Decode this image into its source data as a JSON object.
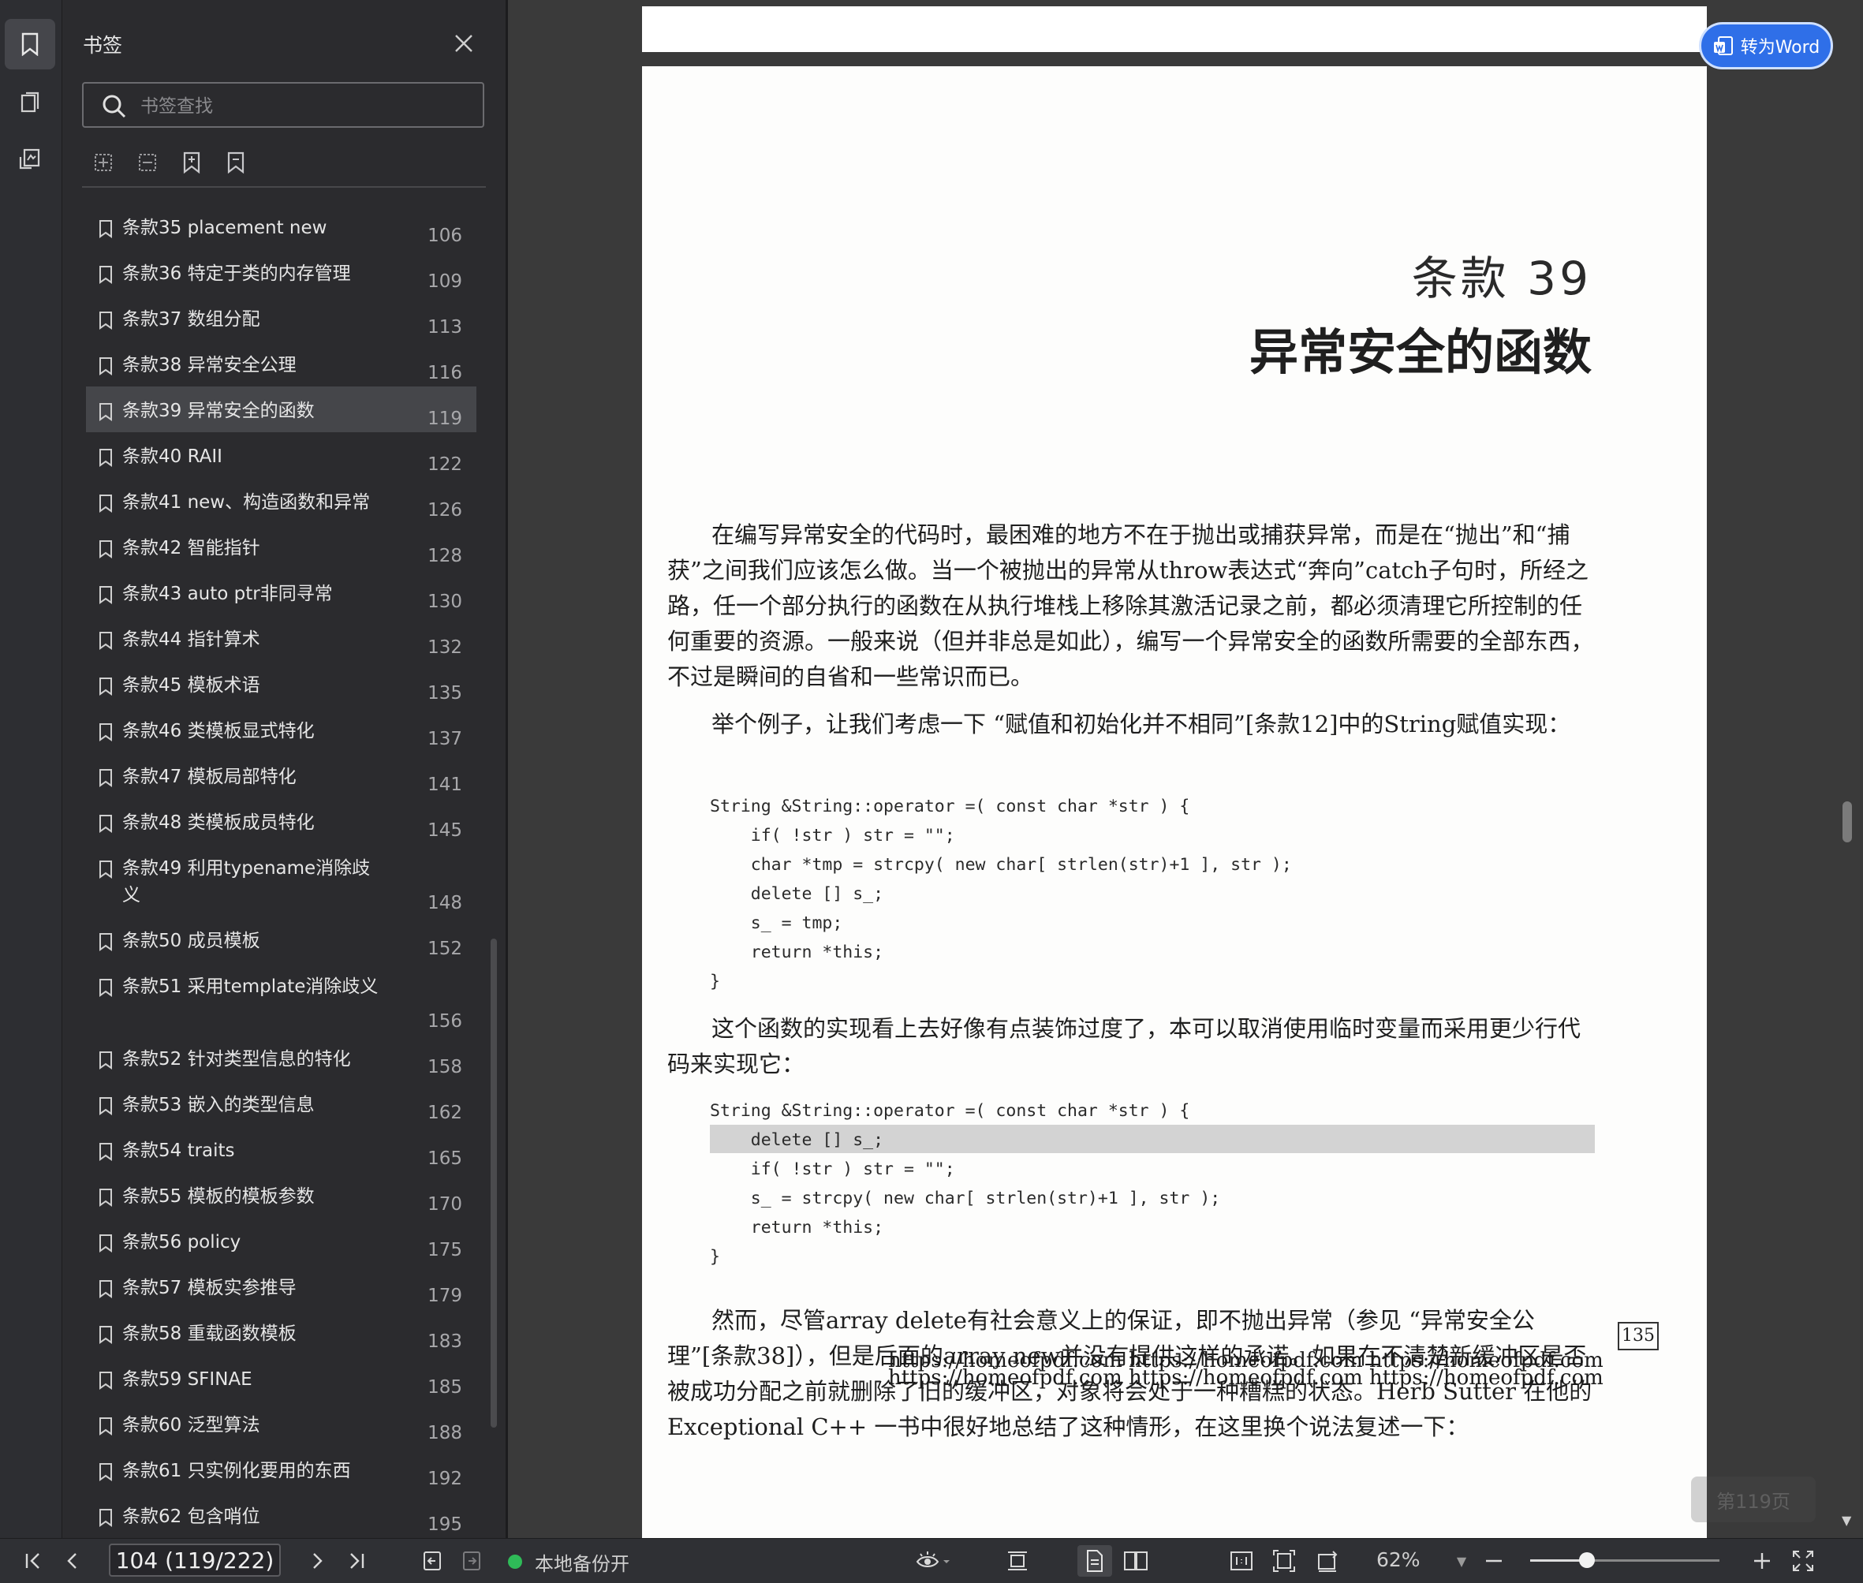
{
  "panel": {
    "title": "书签",
    "search_placeholder": "书签查找",
    "bookmarks": [
      {
        "label": "条款35  placement new",
        "page": "106"
      },
      {
        "label": "条款36  特定于类的内存管理",
        "page": "109"
      },
      {
        "label": "条款37  数组分配",
        "page": "113"
      },
      {
        "label": "条款38  异常安全公理",
        "page": "116"
      },
      {
        "label": "条款39  异常安全的函数",
        "page": "119",
        "selected": true
      },
      {
        "label": "条款40  RAII",
        "page": "122"
      },
      {
        "label": "条款41  new、构造函数和异常",
        "page": "126"
      },
      {
        "label": "条款42  智能指针",
        "page": "128"
      },
      {
        "label": "条款43  auto ptr非同寻常",
        "page": "130"
      },
      {
        "label": "条款44  指针算术",
        "page": "132"
      },
      {
        "label": "条款45  模板术语",
        "page": "135"
      },
      {
        "label": "条款46  类模板显式特化",
        "page": "137"
      },
      {
        "label": "条款47  模板局部特化",
        "page": "141"
      },
      {
        "label": "条款48  类模板成员特化",
        "page": "145"
      },
      {
        "label": "条款49  利用typename消除歧义",
        "page": "148"
      },
      {
        "label": "条款50  成员模板",
        "page": "152"
      },
      {
        "label": "条款51  采用template消除歧义",
        "page": "156"
      },
      {
        "label": "条款52  针对类型信息的特化",
        "page": "158"
      },
      {
        "label": "条款53  嵌入的类型信息",
        "page": "162"
      },
      {
        "label": "条款54  traits",
        "page": "165"
      },
      {
        "label": "条款55  模板的模板参数",
        "page": "170"
      },
      {
        "label": "条款56  policy",
        "page": "175"
      },
      {
        "label": "条款57  模板实参推导",
        "page": "179"
      },
      {
        "label": "条款58  重载函数模板",
        "page": "183"
      },
      {
        "label": "条款59  SFINAE",
        "page": "185"
      },
      {
        "label": "条款60  泛型算法",
        "page": "188"
      },
      {
        "label": "条款61  只实例化要用的东西",
        "page": "192"
      },
      {
        "label": "条款62  包含哨位",
        "page": "195"
      }
    ]
  },
  "document": {
    "convert_button": "转为Word",
    "chapter_number": "条款 39",
    "chapter_title": "异常安全的函数",
    "para1": "在编写异常安全的代码时，最困难的地方不在于抛出或捕获异常，而是在“抛出”和“捕获”之间我们应该怎么做。当一个被抛出的异常从throw表达式“奔向”catch子句时，所经之路，任一个部分执行的函数在从执行堆栈上移除其激活记录之前，都必须清理它所控制的任何重要的资源。一般来说（但并非总是如此），编写一个异常安全的函数所需要的全部东西，不过是瞬间的自省和一些常识而已。",
    "para2": "举个例子，让我们考虑一下 “赋值和初始化并不相同”[条款12]中的String赋值实现：",
    "code1": [
      "String &String::operator =( const char *str ) {",
      "    if( !str ) str = \"\";",
      "    char *tmp = strcpy( new char[ strlen(str)+1 ], str );",
      "    delete [] s_;",
      "    s_ = tmp;",
      "    return *this;",
      "}"
    ],
    "para3": "这个函数的实现看上去好像有点装饰过度了，本可以取消使用临时变量而采用更少行代码来实现它：",
    "code2": [
      "String &String::operator =( const char *str ) {",
      "    delete [] s_;",
      "    if( !str ) str = \"\";",
      "    s_ = strcpy( new char[ strlen(str)+1 ], str );",
      "    return *this;",
      "}"
    ],
    "para4": "然而，尽管array delete有社会意义上的保证，即不抛出异常（参见 “异常安全公理”[条款38]），但是后面的array new并没有提供这样的承诺。如果在不清楚新缓冲区是否被成功分配之前就删除了旧的缓冲区，对象将会处于一种糟糕的状态。Herb Sutter 在他的 Exceptional C++ 一书中很好地总结了这种情形，在这里换个说法复述一下：",
    "page_number": "135",
    "watermark_line1": "https://homeofpdf.com https://homeofpdf.com https://homeofpdf.com",
    "watermark_line2": "https://homeofpdf.com https://homeofpdf.com https://homeofpdf.com",
    "page_tip": "第119页"
  },
  "statusbar": {
    "page_value": "104 (119/222)",
    "backup_label": "本地备份开",
    "zoom": "62%",
    "zoom_fraction": 0.3
  }
}
